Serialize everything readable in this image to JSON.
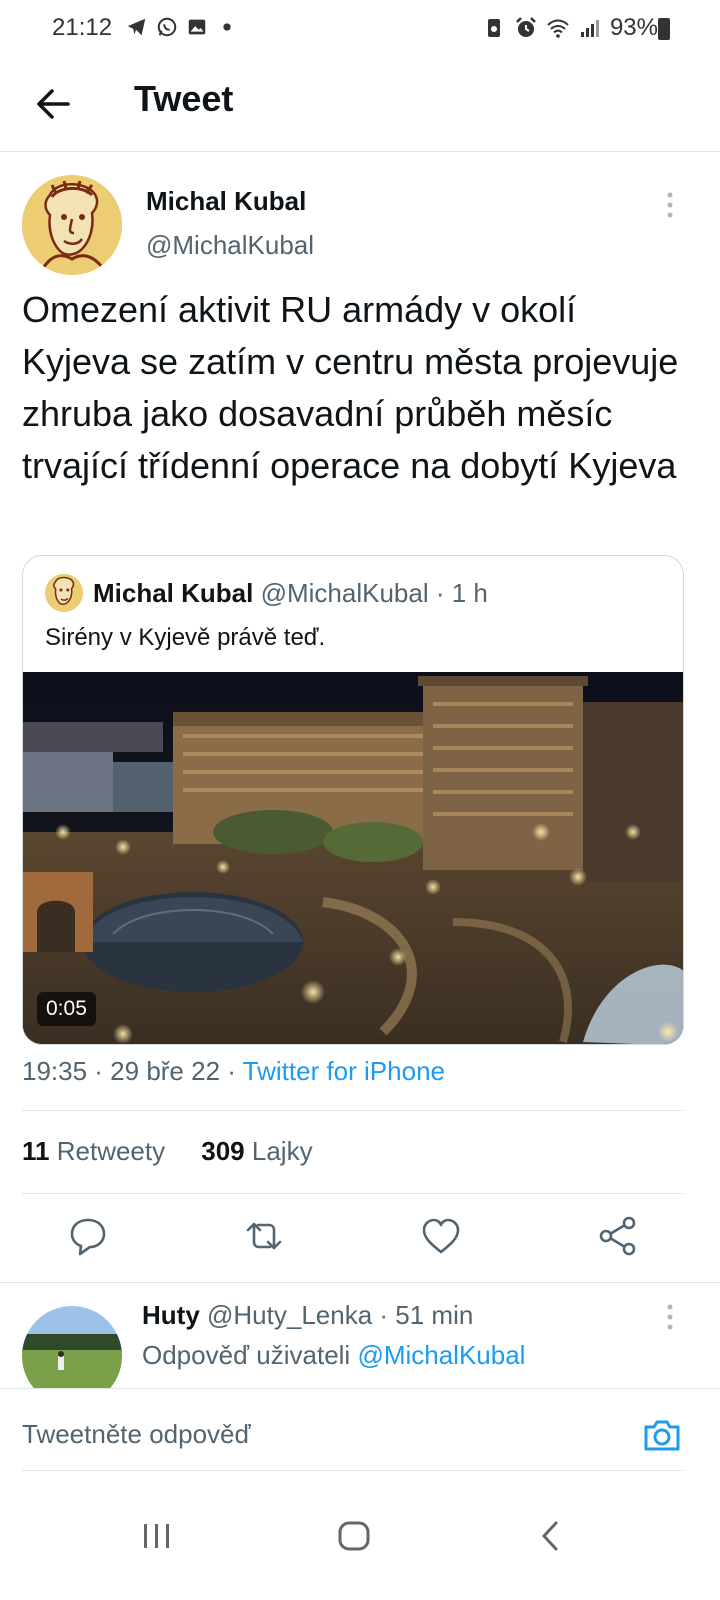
{
  "status_bar": {
    "time": "21:12",
    "battery": "93%"
  },
  "header": {
    "title": "Tweet"
  },
  "tweet": {
    "author_name": "Michal Kubal",
    "author_handle": "@MichalKubal",
    "text": "Omezení aktivit RU armády v okolí Kyjeva se zatím v centru města projevuje zhruba jako dosavadní průběh měsíc trvající třídenní operace na dobytí Kyjeva",
    "timestamp": "19:35 · 29 bře 22 · ",
    "source": "Twitter for iPhone",
    "retweets_count": "11",
    "retweets_label": "Retweety",
    "likes_count": "309",
    "likes_label": "Lajky"
  },
  "quoted_tweet": {
    "author_name": "Michal Kubal",
    "author_handle": "@MichalKubal",
    "separator": " · ",
    "time": "1 h",
    "text": "Sirény v Kyjevě právě teď.",
    "video_duration": "0:05"
  },
  "reply": {
    "author_name": "Huty",
    "author_handle": "@Huty_Lenka",
    "separator": " · ",
    "time": "51 min",
    "reply_prefix": "Odpověď uživateli ",
    "reply_to": "@MichalKubal"
  },
  "composer": {
    "placeholder": "Tweetněte odpověď"
  },
  "colors": {
    "accent": "#1d9bf0",
    "secondary_text": "#536471",
    "primary_text": "#0f1419",
    "divider": "#e1e5e8"
  }
}
